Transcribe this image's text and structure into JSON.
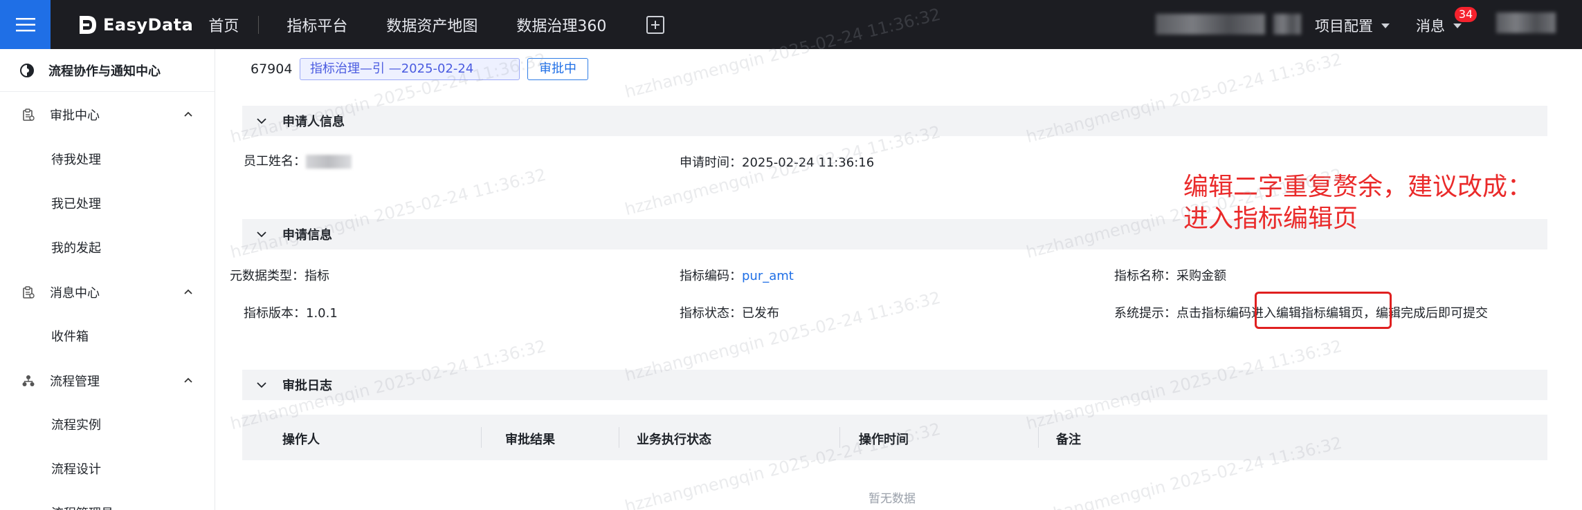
{
  "topbar": {
    "brand": "EasyData",
    "nav": [
      "首页",
      "指标平台",
      "数据资产地图",
      "数据治理360"
    ],
    "project_config": "项目配置",
    "messages": "消息",
    "message_count": "34"
  },
  "sidebar": {
    "header": "流程协作与通知中心",
    "groups": [
      {
        "label": "审批中心",
        "items": [
          "待我处理",
          "我已处理",
          "我的发起"
        ]
      },
      {
        "label": "消息中心",
        "items": [
          "收件箱"
        ]
      },
      {
        "label": "流程管理",
        "items": [
          "流程实例",
          "流程设计",
          "流程管理员"
        ]
      }
    ]
  },
  "request": {
    "id": "67904",
    "name_tag": "指标治理—引        —2025-02-24",
    "status": "审批中"
  },
  "applicant": {
    "section": "申请人信息",
    "name_label": "员工姓名：",
    "time_label": "申请时间：",
    "time_value": "2025-02-24 11:36:16"
  },
  "application": {
    "section": "申请信息",
    "metadata_type_label": "元数据类型：",
    "metadata_type_value": "指标",
    "metric_code_label": "指标编码：",
    "metric_code_value": "pur_amt",
    "metric_name_label": "指标名称：",
    "metric_name_value": "采购金额",
    "metric_version_label": "指标版本：",
    "metric_version_value": "1.0.1",
    "metric_status_label": "指标状态：",
    "metric_status_value": "已发布",
    "hint_label": "系统提示：",
    "hint_value": "点击指标编码进入编辑指标编辑页，编辑完成后即可提交"
  },
  "log": {
    "section": "审批日志",
    "columns": [
      "操作人",
      "审批结果",
      "业务执行状态",
      "操作时间",
      "备注"
    ],
    "empty": "暂无数据"
  },
  "annotation": {
    "line1": "编辑二字重复赘余，建议改成：",
    "line2": "进入指标编辑页"
  },
  "watermark": "hzzhangmengqin 2025-02-24 11:36:32",
  "colors": {
    "topbar_bg": "#1c1d22",
    "accent": "#1f6fe6",
    "annotation_red": "#ea2a2a"
  }
}
